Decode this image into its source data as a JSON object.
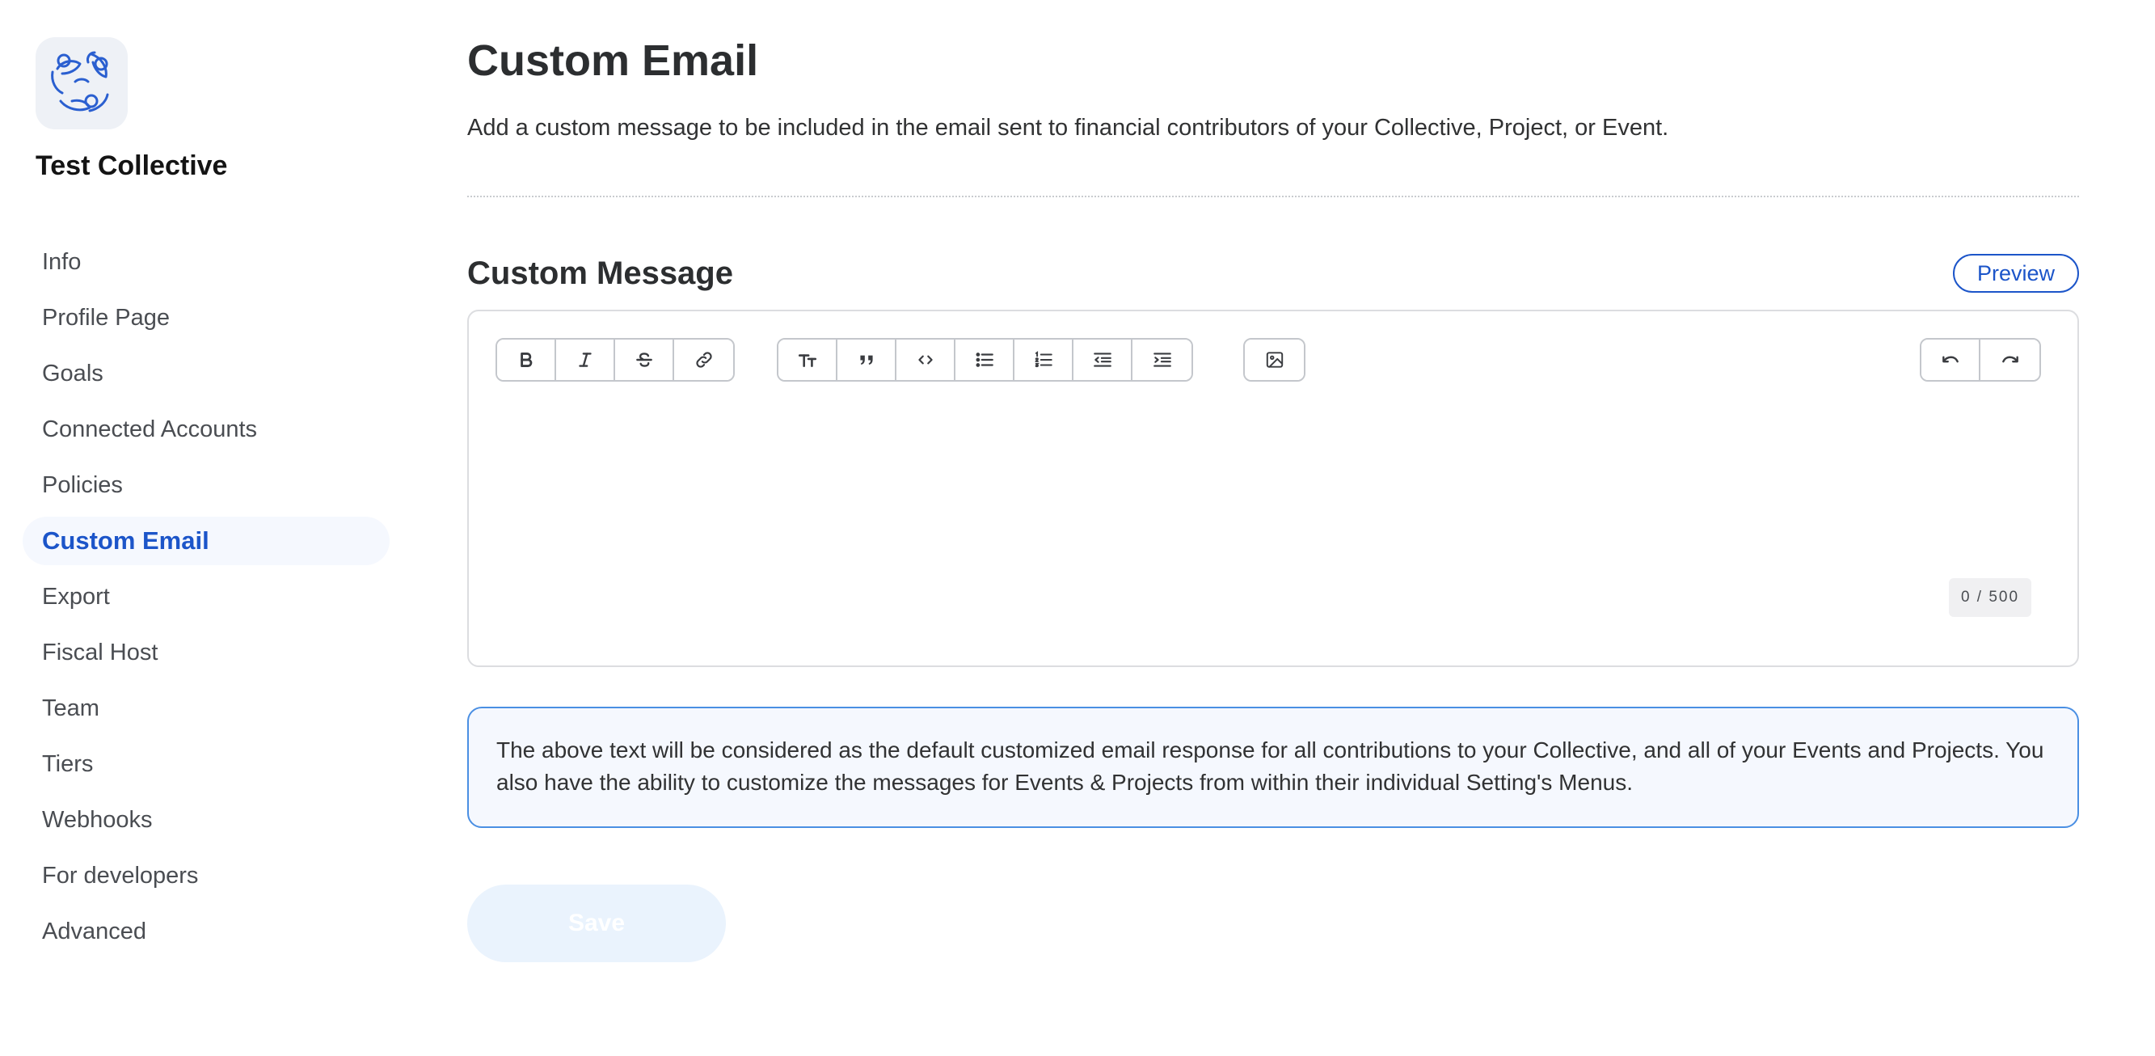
{
  "sidebar": {
    "collective_name": "Test Collective",
    "logo_icon": "lightbulb-hands-icon",
    "items": [
      {
        "label": "Info"
      },
      {
        "label": "Profile Page"
      },
      {
        "label": "Goals"
      },
      {
        "label": "Connected Accounts"
      },
      {
        "label": "Policies"
      },
      {
        "label": "Custom Email",
        "active": true
      },
      {
        "label": "Export"
      },
      {
        "label": "Fiscal Host"
      },
      {
        "label": "Team"
      },
      {
        "label": "Tiers"
      },
      {
        "label": "Webhooks"
      },
      {
        "label": "For developers"
      },
      {
        "label": "Advanced"
      }
    ]
  },
  "main": {
    "title": "Custom Email",
    "description": "Add a custom message to be included in the email sent to financial contributors of your Collective, Project, or Event.",
    "section_title": "Custom Message",
    "preview_label": "Preview",
    "editor": {
      "content": "",
      "counter": "0 / 500",
      "toolbar_icons": [
        "bold-icon",
        "italic-icon",
        "strikethrough-icon",
        "link-icon",
        "heading-icon",
        "quote-icon",
        "code-icon",
        "bullet-list-icon",
        "numbered-list-icon",
        "outdent-icon",
        "indent-icon",
        "image-icon",
        "undo-icon",
        "redo-icon"
      ]
    },
    "info_text": "The above text will be considered as the default customized email response for all contributions to your Collective, and all of your Events and Projects. You also have the ability to customize the messages for Events & Projects from within their individual Setting's Menus.",
    "save_label": "Save"
  },
  "colors": {
    "accent": "#1c55c9",
    "info_border": "#4a8fe3",
    "info_bg": "#f5f8fe",
    "save_disabled_bg": "#eaf3fd"
  }
}
